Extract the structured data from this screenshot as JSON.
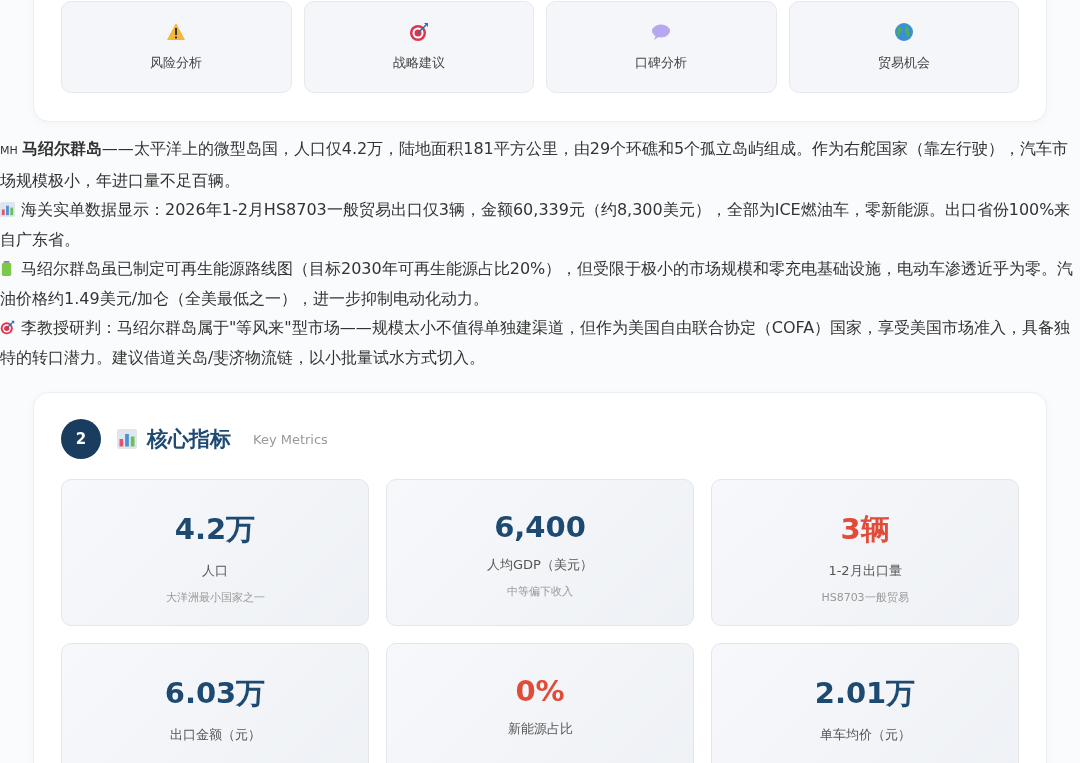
{
  "modules": [
    {
      "kind": "warning",
      "label": "风险分析"
    },
    {
      "kind": "target",
      "label": "战略建议"
    },
    {
      "kind": "speech",
      "label": "口碑分析"
    },
    {
      "kind": "globe",
      "label": "贸易机会"
    }
  ],
  "paragraphs": [
    {
      "kind": "flag",
      "prefix": "MH",
      "text": "**马绍尔群岛**——太平洋上的微型岛国，人口仅4.2万，陆地面积181平方公里，由29个环礁和5个孤立岛屿组成。作为右舵国家（靠左行驶），汽车市场规模极小，年进口量不足百辆。"
    },
    {
      "kind": "chart",
      "text": "海关实单数据显示：2026年1-2月HS8703一般贸易出口仅3辆，金额60,339元（约8,300美元），全部为ICE燃油车，零新能源。出口省份100%来自广东省。"
    },
    {
      "kind": "battery",
      "text": "马绍尔群岛虽已制定可再生能源路线图（目标2030年可再生能源占比20%），但受限于极小的市场规模和零充电基础设施，电动车渗透近乎为零。汽油价格约1.49美元/加仑（全美最低之一），进一步抑制电动化动力。"
    },
    {
      "kind": "target",
      "text": "李教授研判：马绍尔群岛属于\"等风来\"型市场——规模太小不值得单独建渠道，但作为美国自由联合协定（COFA）国家，享受美国市场准入，具备独特的转口潜力。建议借道关岛/斐济物流链，以小批量试水方式切入。"
    }
  ],
  "section": {
    "number": "2",
    "title": "核心指标",
    "subtitle": "Key Metrics",
    "metrics": [
      {
        "value": "4.2万",
        "highlight": false,
        "label": "人口",
        "note": "大洋洲最小国家之一"
      },
      {
        "value": "6,400",
        "highlight": false,
        "label": "人均GDP（美元）",
        "note": "中等偏下收入"
      },
      {
        "value": "3辆",
        "highlight": true,
        "label": "1-2月出口量",
        "note": "HS8703一般贸易"
      },
      {
        "value": "6.03万",
        "highlight": false,
        "label": "出口金额（元）"
      },
      {
        "value": "0%",
        "highlight": true,
        "label": "新能源占比"
      },
      {
        "value": "2.01万",
        "highlight": false,
        "label": "单车均价（元）"
      }
    ]
  }
}
